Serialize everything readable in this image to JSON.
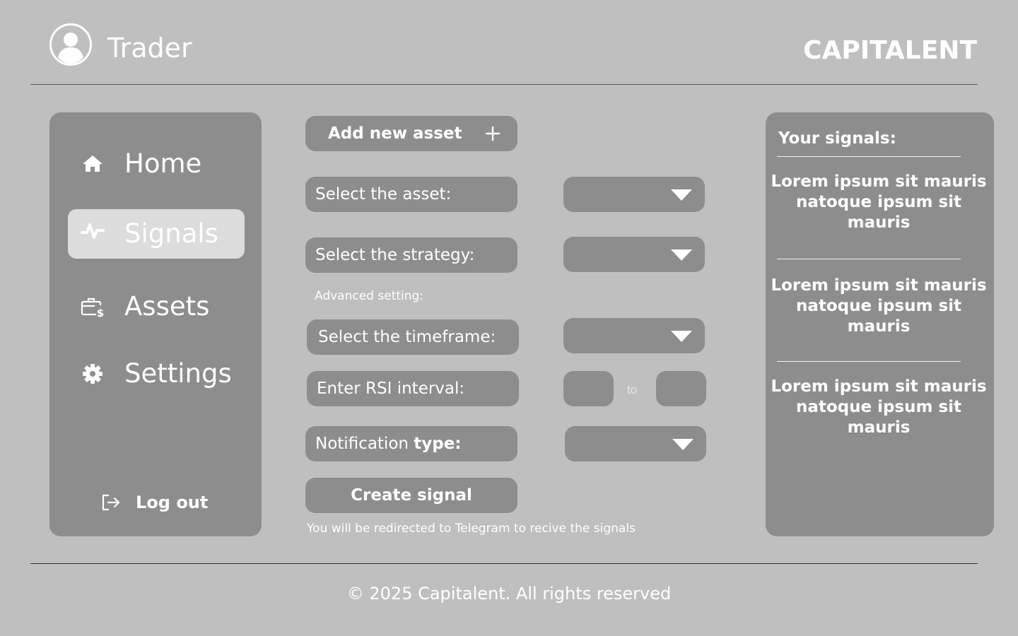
{
  "header": {
    "role": "Trader",
    "brand": "CAPITALENT",
    "user_icon": "user-circle-icon"
  },
  "sidebar": {
    "items": [
      {
        "label": "Home",
        "icon": "home-icon",
        "active": false
      },
      {
        "label": "Signals",
        "icon": "pulse-icon",
        "active": true
      },
      {
        "label": "Assets",
        "icon": "briefcase-dollar-icon",
        "active": false
      },
      {
        "label": "Settings",
        "icon": "gear-icon",
        "active": false
      }
    ],
    "logout": {
      "label": "Log out",
      "icon": "logout-icon"
    }
  },
  "form": {
    "add_asset": "Add new asset",
    "select_asset": "Select the asset:",
    "select_strategy": "Select the strategy:",
    "advanced_label": "Advanced setting:",
    "select_timeframe": "Select the timeframe:",
    "rsi_interval": "Enter RSI interval:",
    "rsi_to": "to",
    "notification_prefix": "Notification ",
    "notification_bold": "type:",
    "create_signal": "Create signal",
    "redirect_note": "You will be redirected to Telegram to recive the signals"
  },
  "signals_panel": {
    "title": "Your signals:",
    "items": [
      "Lorem ipsum sit mauris natoque ipsum sit mauris",
      "Lorem ipsum sit mauris natoque ipsum sit mauris",
      "Lorem ipsum sit mauris natoque ipsum sit mauris"
    ]
  },
  "footer": {
    "copyright": "© 2025 Capitalent. All rights reserved"
  },
  "colors": {
    "background": "#bfbfbf",
    "panel": "#8d8d8d",
    "active_nav": "#dcdcdc",
    "text": "#ffffff"
  }
}
